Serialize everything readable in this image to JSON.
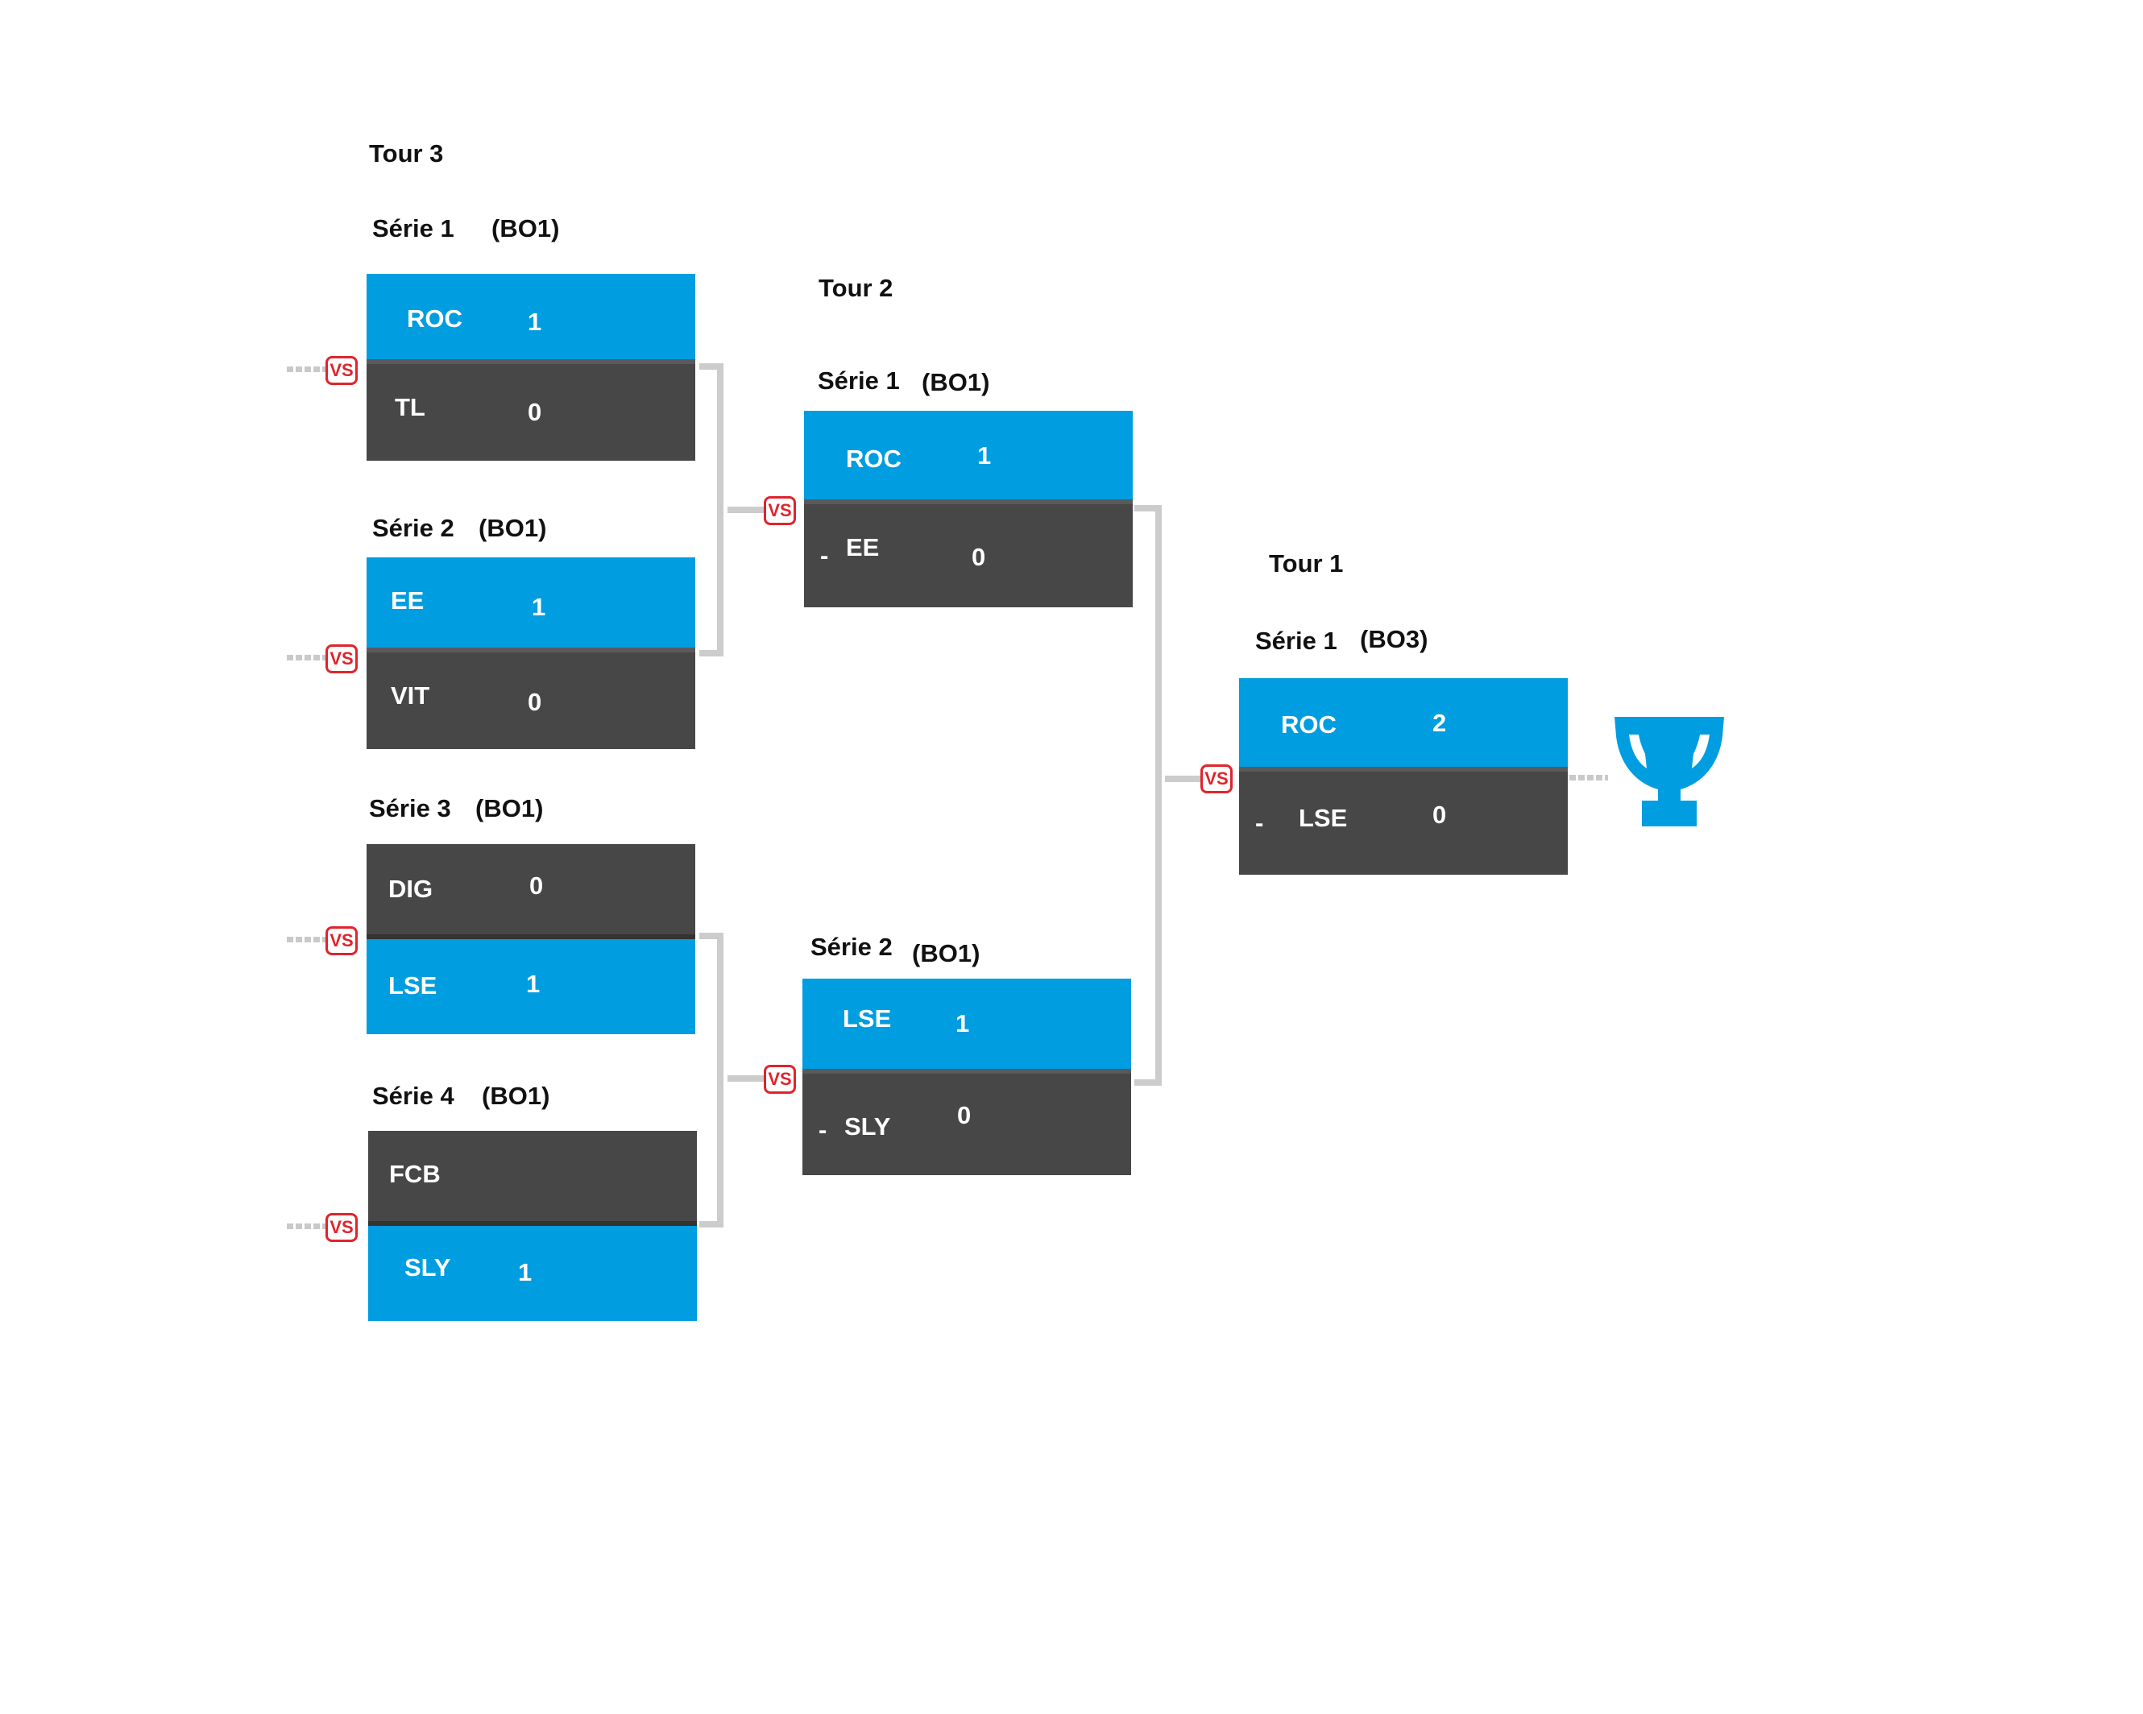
{
  "rounds": {
    "tour3": {
      "title": "Tour 3",
      "series": [
        {
          "name": "Série 1",
          "format": "(BO1)",
          "top": {
            "team": "ROC",
            "score": "1"
          },
          "bottom": {
            "team": "TL",
            "score": "0"
          }
        },
        {
          "name": "Série 2",
          "format": "(BO1)",
          "top": {
            "team": "EE",
            "score": "1"
          },
          "bottom": {
            "team": "VIT",
            "score": "0"
          }
        },
        {
          "name": "Série 3",
          "format": "(BO1)",
          "top": {
            "team": "DIG",
            "score": "0"
          },
          "bottom": {
            "team": "LSE",
            "score": "1"
          }
        },
        {
          "name": "Série 4",
          "format": "(BO1)",
          "top": {
            "team": "FCB",
            "score": ""
          },
          "bottom": {
            "team": "SLY",
            "score": "1"
          }
        }
      ]
    },
    "tour2": {
      "title": "Tour 2",
      "series": [
        {
          "name": "Série 1",
          "format": "(BO1)",
          "top": {
            "team": "ROC",
            "score": "1"
          },
          "bottom": {
            "team": "EE",
            "score": "0",
            "prefix": "-"
          }
        },
        {
          "name": "Série 2",
          "format": "(BO1)",
          "top": {
            "team": "LSE",
            "score": "1"
          },
          "bottom": {
            "team": "SLY",
            "score": "0",
            "prefix": "-"
          }
        }
      ]
    },
    "tour1": {
      "title": "Tour 1",
      "series": [
        {
          "name": "Série 1",
          "format": "(BO3)",
          "top": {
            "team": "ROC",
            "score": "2"
          },
          "bottom": {
            "team": "LSE",
            "score": "0",
            "prefix": "-"
          }
        }
      ]
    }
  },
  "vs_label": "VS",
  "icons": {
    "versus": "vs-badge-icon",
    "champion": "trophy-icon"
  },
  "colors": {
    "winner": "#009de0",
    "loser": "#474747",
    "vs": "#e0242c",
    "connector": "#cccccc"
  }
}
